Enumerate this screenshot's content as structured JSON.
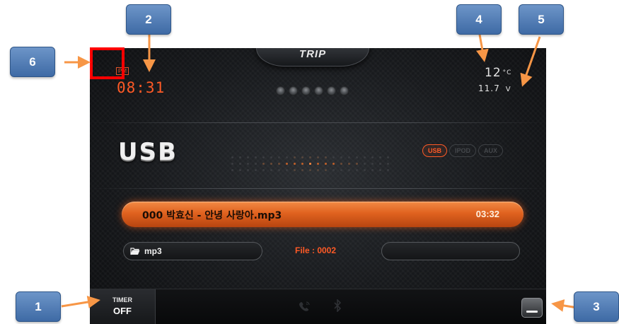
{
  "screen": {
    "trip_label": "TRIP",
    "clock": {
      "ampm": "PM",
      "time": "08:31"
    },
    "temperature": {
      "value": "12",
      "unit": "°C"
    },
    "voltage": {
      "value": "11.7",
      "unit": "V"
    },
    "page_dot_count": 6,
    "source_title": "USB",
    "sources": [
      {
        "label": "USB",
        "active": true
      },
      {
        "label": "IPOD",
        "active": false
      },
      {
        "label": "AUX",
        "active": false
      }
    ],
    "track": {
      "name": "000  박효신 - 안녕 사랑아.mp3",
      "duration": "03:32"
    },
    "folder": {
      "icon": "folder-open-icon",
      "label": "mp3"
    },
    "file_counter": "File : 0002",
    "bottom_bar": {
      "timer": {
        "label": "TIMER",
        "value": "OFF"
      },
      "icons": [
        "phone-icon",
        "bluetooth-icon"
      ],
      "menu_icon": "menu-icon"
    }
  },
  "callouts": [
    "1",
    "2",
    "3",
    "4",
    "5",
    "6"
  ],
  "colors": {
    "accent_orange": "#ff5a26",
    "callout_blue": "#4a76b0",
    "arrow_orange": "#f79646",
    "highlight_red": "#ff0000"
  }
}
